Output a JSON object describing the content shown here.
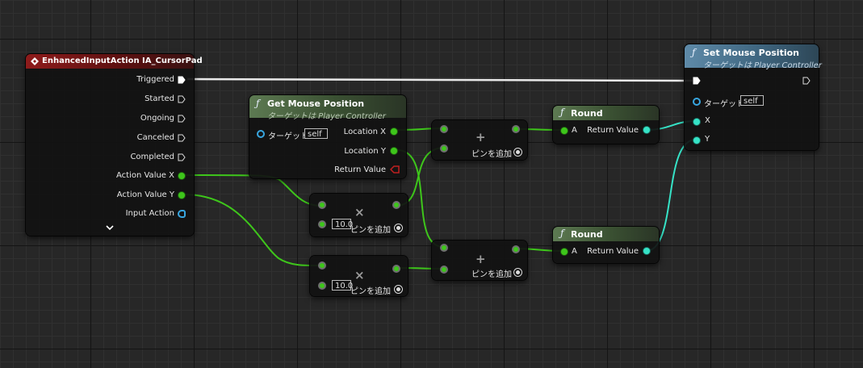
{
  "event_node": {
    "title": "EnhancedInputAction IA_CursorPad",
    "pins": [
      "Triggered",
      "Started",
      "Ongoing",
      "Canceled",
      "Completed",
      "Action Value X",
      "Action Value Y",
      "Input Action"
    ],
    "expand_icon": "chevron-down-icon"
  },
  "get_mouse": {
    "title": "Get Mouse Position",
    "subtitle": "ターゲットは Player Controller",
    "target_label": "ターゲット",
    "target_value": "self",
    "out_x": "Location X",
    "out_y": "Location Y",
    "out_ret": "Return Value"
  },
  "mul_nodes": [
    {
      "value": "10.0",
      "add_pin": "ピンを追加",
      "op": "×"
    },
    {
      "value": "10.0",
      "add_pin": "ピンを追加",
      "op": "×"
    }
  ],
  "add_nodes": [
    {
      "add_pin": "ピンを追加",
      "op": "+"
    },
    {
      "add_pin": "ピンを追加",
      "op": "+"
    }
  ],
  "round_nodes": [
    {
      "title": "Round",
      "in": "A",
      "out": "Return Value"
    },
    {
      "title": "Round",
      "in": "A",
      "out": "Return Value"
    }
  ],
  "set_mouse": {
    "title": "Set Mouse Position",
    "subtitle": "ターゲットは Player Controller",
    "target_label": "ターゲット",
    "target_value": "self",
    "in_x": "X",
    "in_y": "Y"
  },
  "colors": {
    "exec_wire": "#ffffff",
    "float_wire": "#3ec61b",
    "int_wire": "#36e3c7",
    "event_header": "#8e1b1b",
    "function_header": "#3a5032",
    "target_function_header": "#3f6680"
  }
}
